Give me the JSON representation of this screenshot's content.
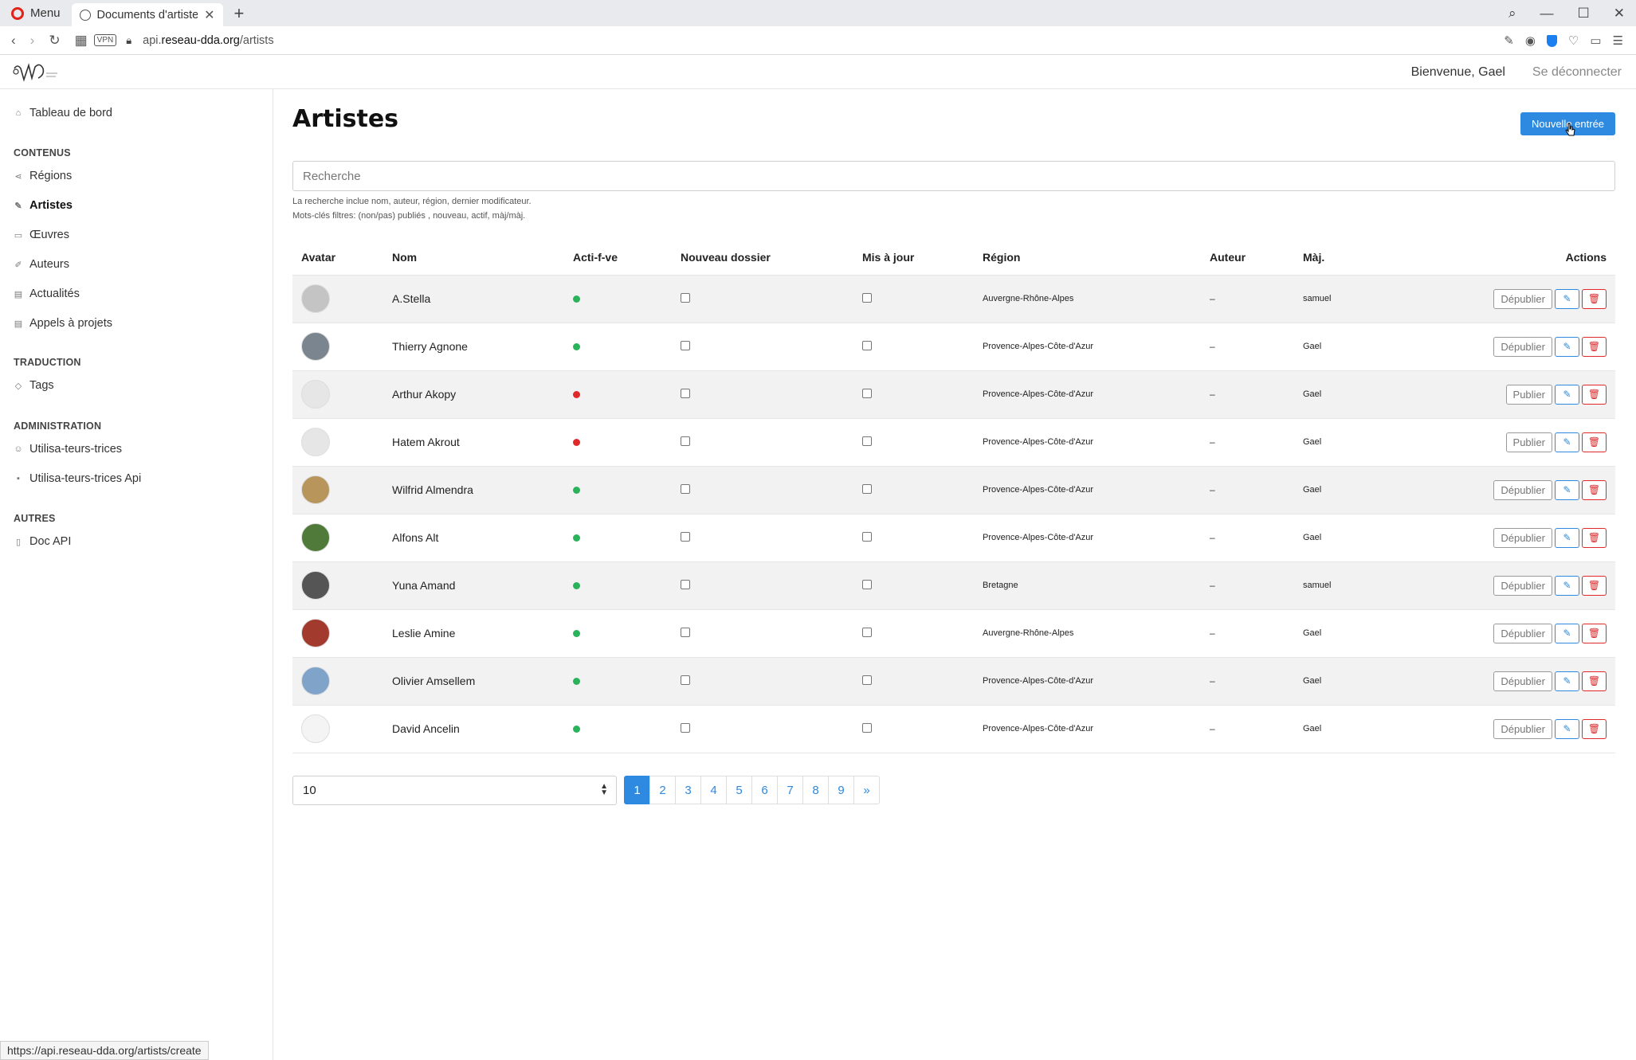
{
  "browser": {
    "menu_label": "Menu",
    "tab_title": "Documents d'artistes - A",
    "url_sub": "api.",
    "url_domain": "reseau-dda.org",
    "url_path": "/artists",
    "vpn_label": "VPN",
    "status_url": "https://api.reseau-dda.org/artists/create"
  },
  "header": {
    "welcome": "Bienvenue, Gael",
    "logout": "Se déconnecter"
  },
  "sidebar": {
    "dashboard": "Tableau de bord",
    "sections": {
      "contenus": "CONTENUS",
      "traduction": "TRADUCTION",
      "administration": "ADMINISTRATION",
      "autres": "AUTRES"
    },
    "items": {
      "regions": "Régions",
      "artistes": "Artistes",
      "oeuvres": "Œuvres",
      "auteurs": "Auteurs",
      "actualites": "Actualités",
      "appels": "Appels à projets",
      "tags": "Tags",
      "utilisateurs": "Utilisa-teurs-trices",
      "utilisateurs_api": "Utilisa-teurs-trices Api",
      "doc_api": "Doc API"
    }
  },
  "main": {
    "title": "Artistes",
    "new_entry": "Nouvelle entrée",
    "search_placeholder": "Recherche",
    "help_line1": "La recherche inclue nom, auteur, région, dernier modificateur.",
    "help_line2": "Mots-clés filtres: (non/pas) publiés , nouveau, actif, màj/màj.",
    "columns": {
      "avatar": "Avatar",
      "nom": "Nom",
      "actif": "Acti-f-ve",
      "nouveau": "Nouveau dossier",
      "mis_a_jour": "Mis à jour",
      "region": "Région",
      "auteur": "Auteur",
      "maj": "Màj.",
      "actions": "Actions"
    },
    "rows": [
      {
        "name": "A.Stella",
        "active": true,
        "region": "Auvergne-Rhône-Alpes",
        "author": "–",
        "updated_by": "samuel",
        "publish": "Dépublier",
        "avatar_color": "#c4c4c4"
      },
      {
        "name": "Thierry Agnone",
        "active": true,
        "region": "Provence-Alpes-Côte-d'Azur",
        "author": "–",
        "updated_by": "Gael",
        "publish": "Dépublier",
        "avatar_color": "#7b8590"
      },
      {
        "name": "Arthur Akopy",
        "active": false,
        "region": "Provence-Alpes-Côte-d'Azur",
        "author": "–",
        "updated_by": "Gael",
        "publish": "Publier",
        "avatar_color": "#e6e6e6"
      },
      {
        "name": "Hatem Akrout",
        "active": false,
        "region": "Provence-Alpes-Côte-d'Azur",
        "author": "–",
        "updated_by": "Gael",
        "publish": "Publier",
        "avatar_color": "#e6e6e6"
      },
      {
        "name": "Wilfrid Almendra",
        "active": true,
        "region": "Provence-Alpes-Côte-d'Azur",
        "author": "–",
        "updated_by": "Gael",
        "publish": "Dépublier",
        "avatar_color": "#b8955a"
      },
      {
        "name": "Alfons Alt",
        "active": true,
        "region": "Provence-Alpes-Côte-d'Azur",
        "author": "–",
        "updated_by": "Gael",
        "publish": "Dépublier",
        "avatar_color": "#4f7a3a"
      },
      {
        "name": "Yuna Amand",
        "active": true,
        "region": "Bretagne",
        "author": "–",
        "updated_by": "samuel",
        "publish": "Dépublier",
        "avatar_color": "#555555"
      },
      {
        "name": "Leslie Amine",
        "active": true,
        "region": "Auvergne-Rhône-Alpes",
        "author": "–",
        "updated_by": "Gael",
        "publish": "Dépublier",
        "avatar_color": "#a33a2e"
      },
      {
        "name": "Olivier Amsellem",
        "active": true,
        "region": "Provence-Alpes-Côte-d'Azur",
        "author": "–",
        "updated_by": "Gael",
        "publish": "Dépublier",
        "avatar_color": "#7fa3c9"
      },
      {
        "name": "David Ancelin",
        "active": true,
        "region": "Provence-Alpes-Côte-d'Azur",
        "author": "–",
        "updated_by": "Gael",
        "publish": "Dépublier",
        "avatar_color": "#f4f4f4"
      }
    ],
    "per_page": "10",
    "pages": [
      "1",
      "2",
      "3",
      "4",
      "5",
      "6",
      "7",
      "8",
      "9",
      "»"
    ],
    "current_page": "1"
  },
  "colors": {
    "accent": "#2d8ae0",
    "active_dot": "#2ab35b",
    "inactive_dot": "#e02a2a",
    "delete": "#e02a2a"
  }
}
